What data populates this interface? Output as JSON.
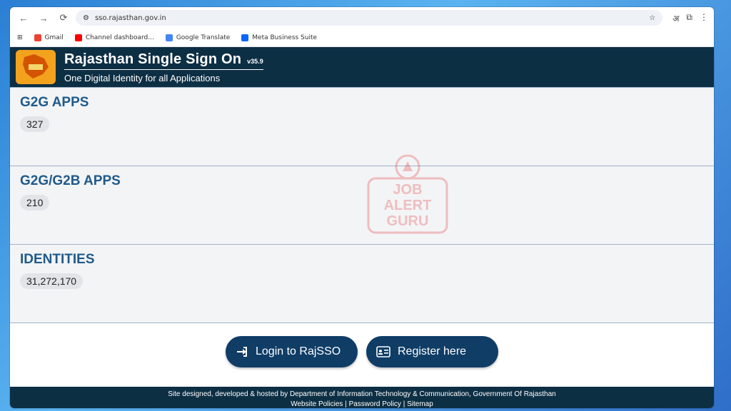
{
  "browser": {
    "url": "sso.rajasthan.gov.in",
    "translate_glyph": "अ",
    "bookmarks": [
      {
        "label": "Gmail",
        "color": "#ea4335"
      },
      {
        "label": "Channel dashboard...",
        "color": "#ff0000"
      },
      {
        "label": "Google Translate",
        "color": "#4285f4"
      },
      {
        "label": "Meta Business Suite",
        "color": "#0866ff"
      }
    ]
  },
  "header": {
    "title": "Rajasthan Single Sign On",
    "version": "v35.9",
    "tagline": "One Digital Identity for all Applications"
  },
  "stats": [
    {
      "title": "G2G APPS",
      "count": "327"
    },
    {
      "title": "G2G/G2B APPS",
      "count": "210"
    },
    {
      "title": "IDENTITIES",
      "count": "31,272,170"
    }
  ],
  "actions": {
    "login_label": "Login to RajSSO",
    "register_label": "Register here"
  },
  "footer": {
    "line1": "Site designed, developed & hosted by Department of Information Technology & Communication, Government Of Rajasthan",
    "line2": "Website Policies | Password Policy | Sitemap"
  },
  "watermark": {
    "line1": "JOB",
    "line2": "ALERT",
    "line3": "GURU"
  },
  "colors": {
    "header_bg": "#0d2f44",
    "accent": "#1f5a8a",
    "button_bg": "#0f3d66"
  }
}
